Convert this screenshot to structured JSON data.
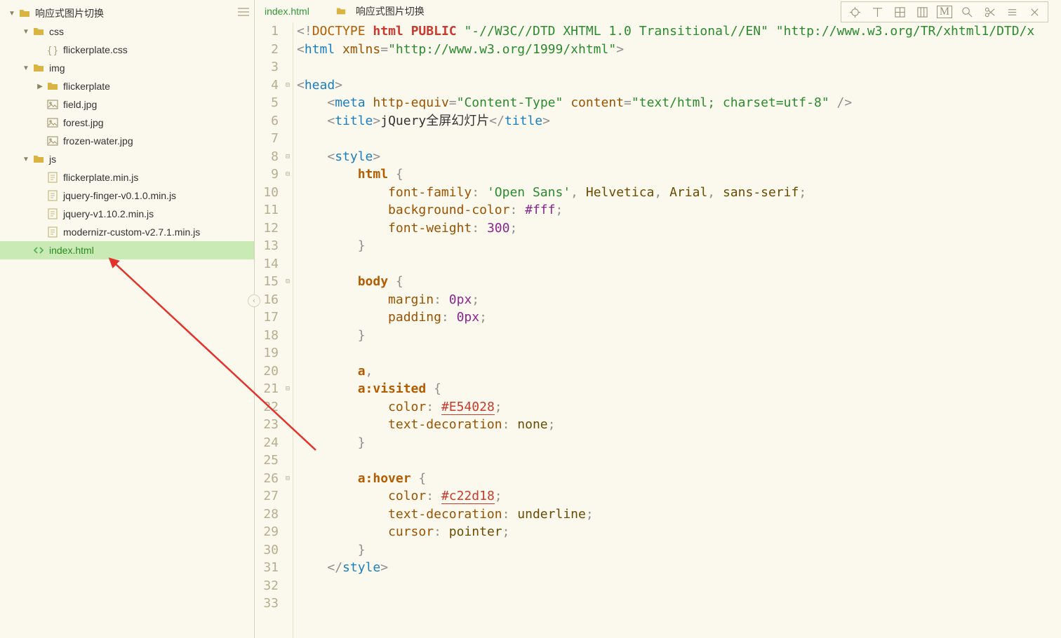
{
  "sidebar": {
    "root": {
      "label": "响应式图片切换",
      "children": [
        {
          "label": "css",
          "type": "folder",
          "expanded": true,
          "indent": 1,
          "children": [
            {
              "label": "flickerplate.css",
              "type": "css",
              "indent": 2
            }
          ]
        },
        {
          "label": "img",
          "type": "folder",
          "expanded": true,
          "indent": 1,
          "children": [
            {
              "label": "flickerplate",
              "type": "folder",
              "expanded": false,
              "indent": 2,
              "arrow": "right"
            },
            {
              "label": "field.jpg",
              "type": "img",
              "indent": 2
            },
            {
              "label": "forest.jpg",
              "type": "img",
              "indent": 2
            },
            {
              "label": "frozen-water.jpg",
              "type": "img",
              "indent": 2
            }
          ]
        },
        {
          "label": "js",
          "type": "folder",
          "expanded": true,
          "indent": 1,
          "children": [
            {
              "label": "flickerplate.min.js",
              "type": "js",
              "indent": 2
            },
            {
              "label": "jquery-finger-v0.1.0.min.js",
              "type": "js",
              "indent": 2
            },
            {
              "label": "jquery-v1.10.2.min.js",
              "type": "js",
              "indent": 2
            },
            {
              "label": "modernizr-custom-v2.7.1.min.js",
              "type": "js",
              "indent": 2
            }
          ]
        },
        {
          "label": "index.html",
          "type": "html",
          "indent": 1,
          "selected": true
        }
      ]
    }
  },
  "tabs": {
    "active": {
      "label": "index.html"
    },
    "secondary": {
      "label": "响应式图片切换"
    }
  },
  "code": {
    "lines": [
      {
        "n": 1,
        "fold": "",
        "segs": [
          [
            "<!",
            "punc"
          ],
          [
            "DOCTYPE",
            "doctype"
          ],
          [
            " ",
            "text"
          ],
          [
            "html",
            "kw"
          ],
          [
            " ",
            "text"
          ],
          [
            "PUBLIC",
            "kw"
          ],
          [
            " ",
            "text"
          ],
          [
            "\"-//W3C//DTD XHTML 1.0 Transitional//EN\"",
            "str"
          ],
          [
            " ",
            "text"
          ],
          [
            "\"http://www.w3.org/TR/xhtml1/DTD/x",
            "str"
          ]
        ]
      },
      {
        "n": 2,
        "fold": "",
        "segs": [
          [
            "<",
            "punc"
          ],
          [
            "html",
            "tag"
          ],
          [
            " ",
            "text"
          ],
          [
            "xmlns",
            "attr"
          ],
          [
            "=",
            "punc"
          ],
          [
            "\"http://www.w3.org/1999/xhtml\"",
            "str"
          ],
          [
            ">",
            "punc"
          ]
        ]
      },
      {
        "n": 3,
        "fold": "",
        "segs": []
      },
      {
        "n": 4,
        "fold": "⊟",
        "segs": [
          [
            "<",
            "punc"
          ],
          [
            "head",
            "tag"
          ],
          [
            ">",
            "punc"
          ]
        ]
      },
      {
        "n": 5,
        "fold": "",
        "segs": [
          [
            "    ",
            "text"
          ],
          [
            "<",
            "punc"
          ],
          [
            "meta",
            "tag"
          ],
          [
            " ",
            "text"
          ],
          [
            "http-equiv",
            "attr"
          ],
          [
            "=",
            "punc"
          ],
          [
            "\"Content-Type\"",
            "str"
          ],
          [
            " ",
            "text"
          ],
          [
            "content",
            "attr"
          ],
          [
            "=",
            "punc"
          ],
          [
            "\"text/html; charset=utf-8\"",
            "str"
          ],
          [
            " />",
            "punc"
          ]
        ]
      },
      {
        "n": 6,
        "fold": "",
        "segs": [
          [
            "    ",
            "text"
          ],
          [
            "<",
            "punc"
          ],
          [
            "title",
            "tag"
          ],
          [
            ">",
            "punc"
          ],
          [
            "jQuery全屏幻灯片",
            "text"
          ],
          [
            "</",
            "punc"
          ],
          [
            "title",
            "tag"
          ],
          [
            ">",
            "punc"
          ]
        ]
      },
      {
        "n": 7,
        "fold": "",
        "segs": []
      },
      {
        "n": 8,
        "fold": "⊟",
        "segs": [
          [
            "    ",
            "text"
          ],
          [
            "<",
            "punc"
          ],
          [
            "style",
            "tag"
          ],
          [
            ">",
            "punc"
          ]
        ]
      },
      {
        "n": 9,
        "fold": "⊟",
        "segs": [
          [
            "        ",
            "text"
          ],
          [
            "html",
            "sel"
          ],
          [
            " {",
            "punc"
          ]
        ]
      },
      {
        "n": 10,
        "fold": "",
        "segs": [
          [
            "            ",
            "text"
          ],
          [
            "font-family",
            "prop"
          ],
          [
            ": ",
            "punc"
          ],
          [
            "'Open Sans'",
            "str"
          ],
          [
            ", ",
            "punc"
          ],
          [
            "Helvetica",
            "val"
          ],
          [
            ", ",
            "punc"
          ],
          [
            "Arial",
            "val"
          ],
          [
            ", ",
            "punc"
          ],
          [
            "sans-serif",
            "val"
          ],
          [
            ";",
            "punc"
          ]
        ]
      },
      {
        "n": 11,
        "fold": "",
        "segs": [
          [
            "            ",
            "text"
          ],
          [
            "background-color",
            "prop"
          ],
          [
            ": ",
            "punc"
          ],
          [
            "#fff",
            "num"
          ],
          [
            ";",
            "punc"
          ]
        ]
      },
      {
        "n": 12,
        "fold": "",
        "segs": [
          [
            "            ",
            "text"
          ],
          [
            "font-weight",
            "prop"
          ],
          [
            ": ",
            "punc"
          ],
          [
            "300",
            "num"
          ],
          [
            ";",
            "punc"
          ]
        ]
      },
      {
        "n": 13,
        "fold": "",
        "segs": [
          [
            "        ",
            "text"
          ],
          [
            "}",
            "punc"
          ]
        ]
      },
      {
        "n": 14,
        "fold": "",
        "segs": []
      },
      {
        "n": 15,
        "fold": "⊟",
        "segs": [
          [
            "        ",
            "text"
          ],
          [
            "body",
            "sel"
          ],
          [
            " {",
            "punc"
          ]
        ]
      },
      {
        "n": 16,
        "fold": "",
        "segs": [
          [
            "            ",
            "text"
          ],
          [
            "margin",
            "prop"
          ],
          [
            ": ",
            "punc"
          ],
          [
            "0px",
            "num"
          ],
          [
            ";",
            "punc"
          ]
        ]
      },
      {
        "n": 17,
        "fold": "",
        "segs": [
          [
            "            ",
            "text"
          ],
          [
            "padding",
            "prop"
          ],
          [
            ": ",
            "punc"
          ],
          [
            "0px",
            "num"
          ],
          [
            ";",
            "punc"
          ]
        ]
      },
      {
        "n": 18,
        "fold": "",
        "segs": [
          [
            "        ",
            "text"
          ],
          [
            "}",
            "punc"
          ]
        ]
      },
      {
        "n": 19,
        "fold": "",
        "segs": []
      },
      {
        "n": 20,
        "fold": "",
        "segs": [
          [
            "        ",
            "text"
          ],
          [
            "a",
            "sel"
          ],
          [
            ",",
            "punc"
          ]
        ]
      },
      {
        "n": 21,
        "fold": "⊟",
        "segs": [
          [
            "        ",
            "text"
          ],
          [
            "a:visited",
            "sel"
          ],
          [
            " {",
            "punc"
          ]
        ]
      },
      {
        "n": 22,
        "fold": "",
        "segs": [
          [
            "            ",
            "text"
          ],
          [
            "color",
            "prop"
          ],
          [
            ": ",
            "punc"
          ],
          [
            "#E54028",
            "hex"
          ],
          [
            ";",
            "punc"
          ]
        ]
      },
      {
        "n": 23,
        "fold": "",
        "segs": [
          [
            "            ",
            "text"
          ],
          [
            "text-decoration",
            "prop"
          ],
          [
            ": ",
            "punc"
          ],
          [
            "none",
            "val"
          ],
          [
            ";",
            "punc"
          ]
        ]
      },
      {
        "n": 24,
        "fold": "",
        "segs": [
          [
            "        ",
            "text"
          ],
          [
            "}",
            "punc"
          ]
        ]
      },
      {
        "n": 25,
        "fold": "",
        "segs": []
      },
      {
        "n": 26,
        "fold": "⊟",
        "segs": [
          [
            "        ",
            "text"
          ],
          [
            "a:hover",
            "sel"
          ],
          [
            " {",
            "punc"
          ]
        ]
      },
      {
        "n": 27,
        "fold": "",
        "segs": [
          [
            "            ",
            "text"
          ],
          [
            "color",
            "prop"
          ],
          [
            ": ",
            "punc"
          ],
          [
            "#c22d18",
            "hex"
          ],
          [
            ";",
            "punc"
          ]
        ]
      },
      {
        "n": 28,
        "fold": "",
        "segs": [
          [
            "            ",
            "text"
          ],
          [
            "text-decoration",
            "prop"
          ],
          [
            ": ",
            "punc"
          ],
          [
            "underline",
            "val"
          ],
          [
            ";",
            "punc"
          ]
        ]
      },
      {
        "n": 29,
        "fold": "",
        "segs": [
          [
            "            ",
            "text"
          ],
          [
            "cursor",
            "prop"
          ],
          [
            ": ",
            "punc"
          ],
          [
            "pointer",
            "val"
          ],
          [
            ";",
            "punc"
          ]
        ]
      },
      {
        "n": 30,
        "fold": "",
        "segs": [
          [
            "        ",
            "text"
          ],
          [
            "}",
            "punc"
          ]
        ]
      },
      {
        "n": 31,
        "fold": "",
        "segs": [
          [
            "    ",
            "text"
          ],
          [
            "</",
            "punc"
          ],
          [
            "style",
            "tag"
          ],
          [
            ">",
            "punc"
          ]
        ]
      },
      {
        "n": 32,
        "fold": "",
        "segs": []
      },
      {
        "n": 33,
        "fold": "",
        "segs": []
      }
    ]
  },
  "toolbar": {
    "icons": [
      "target",
      "text-top",
      "grid",
      "columns",
      "m-mark",
      "search",
      "scissors",
      "menu",
      "close"
    ]
  }
}
